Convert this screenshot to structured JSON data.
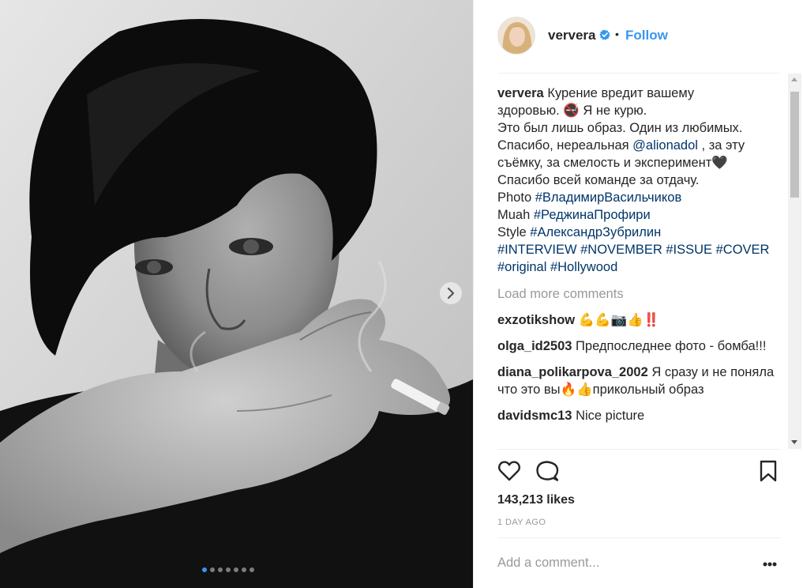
{
  "post": {
    "image_alt": "Black and white portrait of a woman with short dark hair holding a cigarette",
    "carousel": {
      "count": 7,
      "active": 0
    },
    "next_icon": "chevron-right-icon"
  },
  "header": {
    "username": "ververa",
    "verified_icon": "verified-badge-icon",
    "separator": "•",
    "follow_label": "Follow",
    "follow_color": "#3897f0"
  },
  "caption": {
    "username": "ververa",
    "lines": [
      "Курение вредит вашему",
      "здоровью. 🚭 Я не курю.",
      "Это был лишь образ. Один из любимых."
    ],
    "line4_pre": "Спасибо, нереальная ",
    "line4_mention": "@alionadol",
    "line4_post": " , за эту",
    "line5": "съёмку, за смелость и эксперимент🖤",
    "line6": "Спасибо всей команде за отдачу.",
    "photo_label": "Photo ",
    "photo_tag": "#ВладимирВасильчиков",
    "muah_label": "Muah ",
    "muah_tag": "#РеджинаПрофири",
    "style_label": "Style ",
    "style_tag": "#АлександрЗубрилин",
    "tags_line1": "#INTERVIEW #NOVEMBER #ISSUE #COVER",
    "tags_line2": "#original #Hollywood"
  },
  "load_more": "Load more comments",
  "comments": [
    {
      "username": "exzotikshow",
      "text": " 💪💪📷👍‼️"
    },
    {
      "username": "olga_id2503",
      "text": " Предпоследнее фото - бомба!!!"
    },
    {
      "username": "diana_polikarpova_2002",
      "text": " Я сразу и не поняла что это вы🔥👍прикольный образ"
    },
    {
      "username": "davidsmc13",
      "text": " Nice picture"
    }
  ],
  "actions": {
    "like_icon": "heart-outline-icon",
    "comment_icon": "comment-bubble-icon",
    "save_icon": "bookmark-icon"
  },
  "likes": "143,213 likes",
  "time_ago": "1 DAY AGO",
  "add_comment_placeholder": "Add a comment...",
  "more_options_icon": "more-options-icon"
}
